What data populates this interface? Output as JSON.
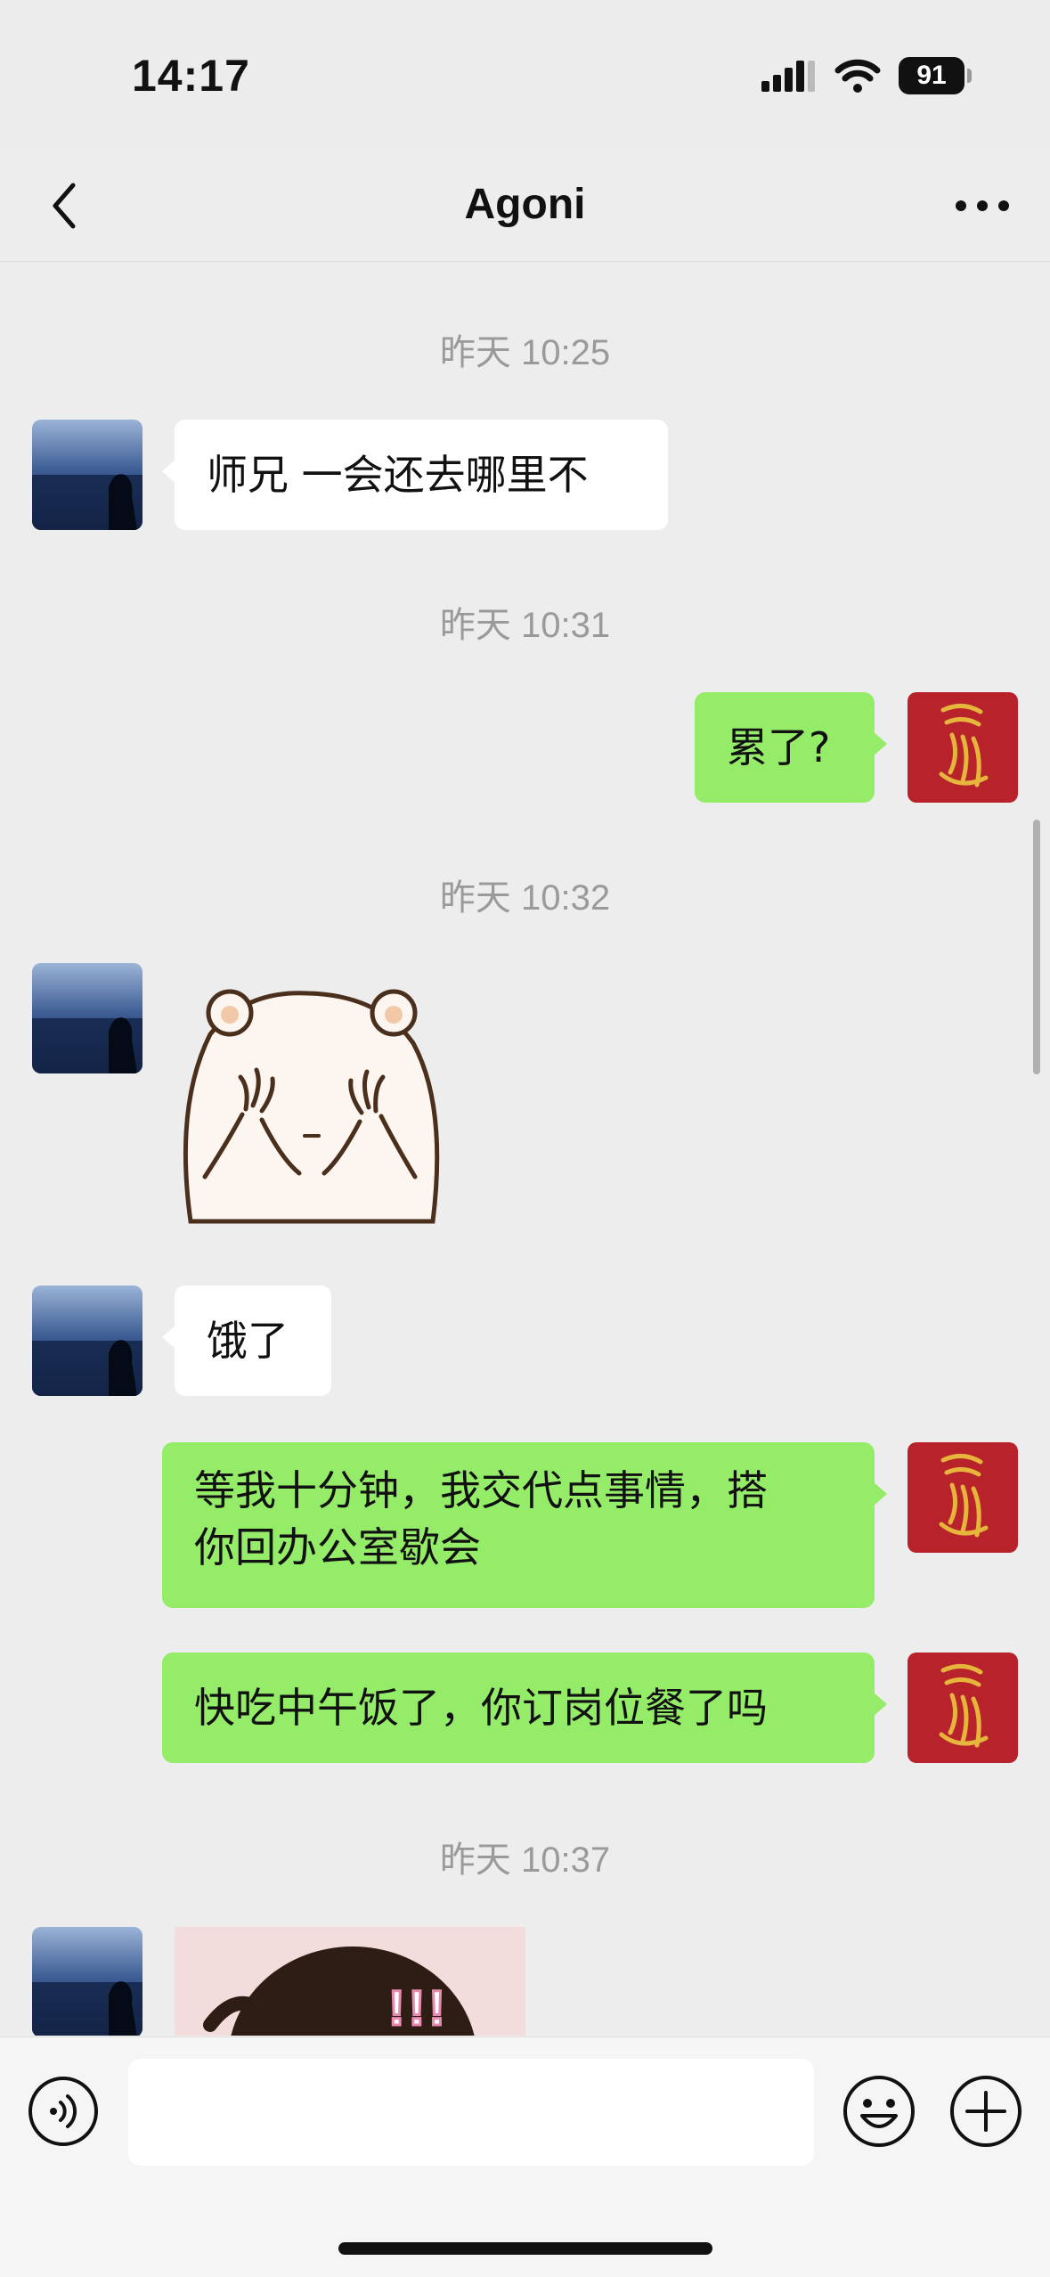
{
  "status_bar": {
    "time": "14:17",
    "battery": "91"
  },
  "nav": {
    "title": "Agoni"
  },
  "messages": {
    "ts1": "昨天 10:25",
    "m1": "师兄 一会还去哪里不",
    "ts2": "昨天 10:31",
    "m2": "累了?",
    "ts3": "昨天 10:32",
    "m4": "饿了",
    "m5_line1": "等我十分钟，我交代点事情，搭",
    "m5_line2": "你回办公室歇会",
    "m6": "快吃中午饭了，你订岗位餐了吗",
    "ts4": "昨天 10:37",
    "m7_sticker_text": "!!!"
  },
  "input": {
    "placeholder": ""
  }
}
